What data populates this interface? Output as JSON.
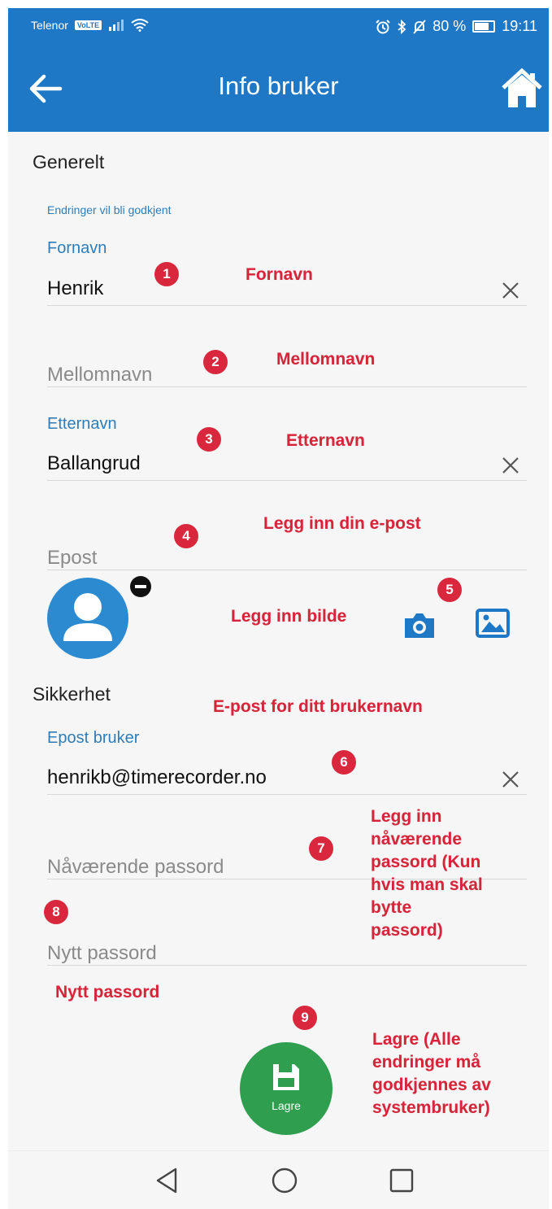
{
  "status_bar": {
    "carrier": "Telenor",
    "network_tag": "VoLTE",
    "battery": "80 %",
    "time": "19:11"
  },
  "app_bar": {
    "title": "Info bruker"
  },
  "general": {
    "title": "Generelt",
    "hint": "Endringer vil bli godkjent",
    "first_name": {
      "label": "Fornavn",
      "value": "Henrik"
    },
    "middle_name": {
      "placeholder": "Mellomnavn"
    },
    "last_name": {
      "label": "Etternavn",
      "value": "Ballangrud"
    },
    "email": {
      "placeholder": "Epost"
    }
  },
  "security": {
    "title": "Sikkerhet",
    "user_email": {
      "label": "Epost bruker",
      "value": "henrikb@timerecorder.no"
    },
    "current_password": {
      "placeholder": "Nåværende passord"
    },
    "new_password": {
      "placeholder": "Nytt passord"
    }
  },
  "fab": {
    "label": "Lagre"
  },
  "markers": [
    "1",
    "2",
    "3",
    "4",
    "5",
    "6",
    "7",
    "8",
    "9"
  ],
  "annotations": {
    "first_name": "Fornavn",
    "middle_name": "Mellomnavn",
    "last_name": "Etternavn",
    "email": "Legg inn din e-post",
    "image": "Legg inn bilde",
    "username": "E-post for ditt brukernavn",
    "current_password": [
      "Legg inn",
      "nåværende",
      "passord (Kun",
      "hvis man skal",
      "bytte",
      "passord)"
    ],
    "new_password": "Nytt passord",
    "save": [
      "Lagre (Alle",
      "endringer må",
      "godkjennes av",
      "systembruker)"
    ]
  },
  "colors": {
    "primary": "#1e78c6",
    "label_blue": "#2f7db8",
    "annotation_red": "#d6253a",
    "fab_green": "#2f9e4f"
  },
  "icons": [
    "arrow-back-icon",
    "home-icon",
    "clear-icon",
    "avatar-icon",
    "remove-icon",
    "camera-icon",
    "image-icon",
    "save-icon",
    "nav-back-icon",
    "nav-home-icon",
    "nav-recents-icon"
  ]
}
